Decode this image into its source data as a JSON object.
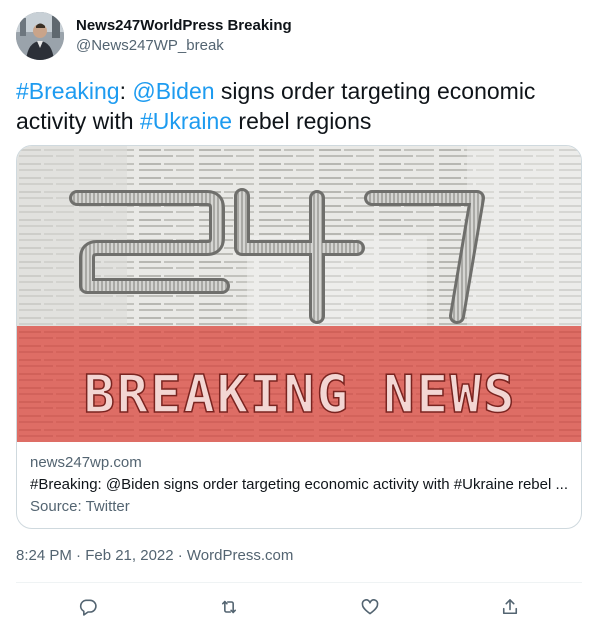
{
  "tweet": {
    "display_name": "News247WorldPress Breaking",
    "handle": "@News247WP_break",
    "text_parts": {
      "hashtag_breaking": "#Breaking",
      "colon": ": ",
      "mention_biden": "@Biden",
      "middle": " signs order targeting economic activity with ",
      "hashtag_ukraine": "#Ukraine",
      "end": " rebel regions"
    },
    "timestamp": "8:24 PM · Feb 21, 2022 · WordPress.com"
  },
  "card": {
    "image_logo_text": "247",
    "image_banner_text": "BREAKING NEWS",
    "domain": "news247wp.com",
    "title": "#Breaking: @Biden signs order targeting economic activity with #Ukraine rebel ...",
    "source": "Source: Twitter",
    "banner_color": "#d9443c"
  },
  "actions": [
    {
      "name": "reply",
      "icon": "reply-icon"
    },
    {
      "name": "retweet",
      "icon": "retweet-icon"
    },
    {
      "name": "like",
      "icon": "heart-icon"
    },
    {
      "name": "share",
      "icon": "share-icon"
    }
  ],
  "colors": {
    "link": "#1d9bf0",
    "secondary_text": "#536471",
    "primary_text": "#0f1419",
    "border": "#cfd9de"
  }
}
